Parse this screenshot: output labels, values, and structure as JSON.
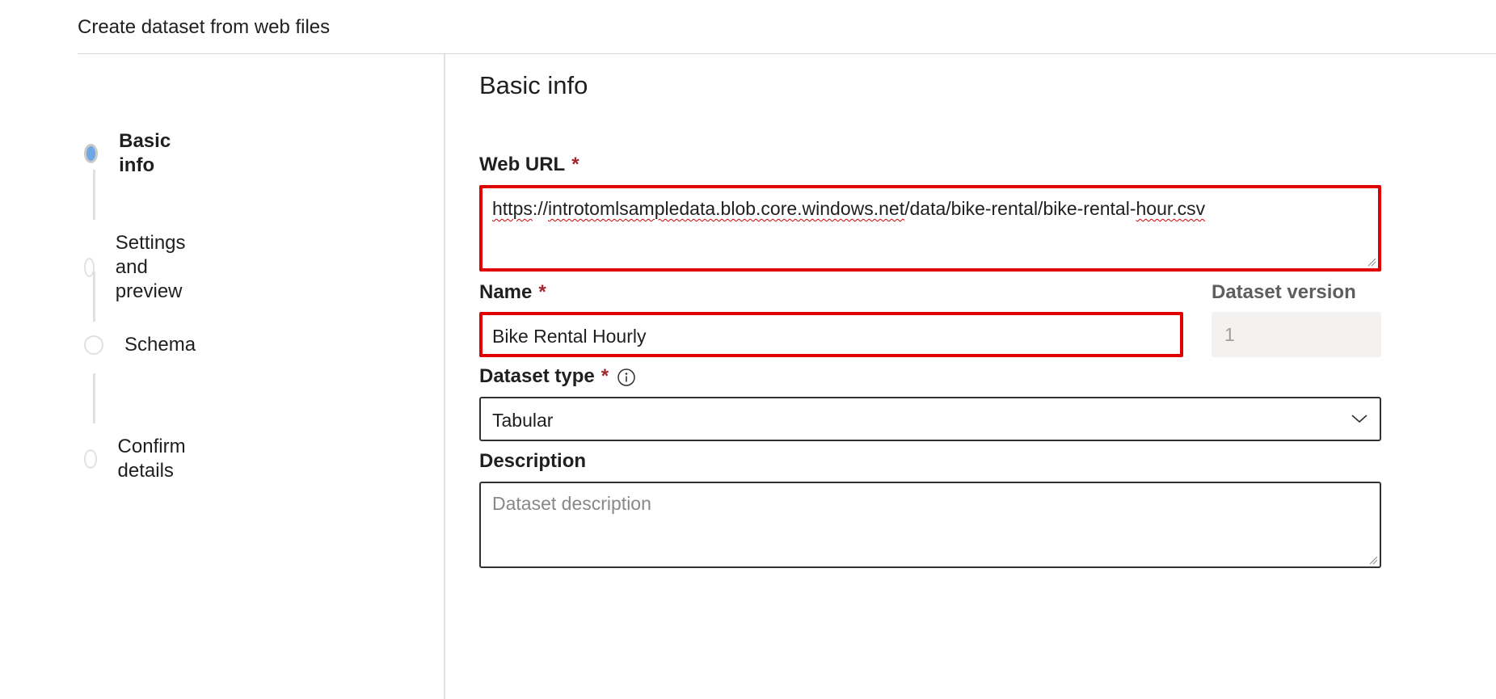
{
  "header": {
    "title": "Create dataset from web files"
  },
  "steps": [
    {
      "label": "Basic info",
      "active": true
    },
    {
      "label": "Settings and preview",
      "active": false
    },
    {
      "label": "Schema",
      "active": false
    },
    {
      "label": "Confirm details",
      "active": false
    }
  ],
  "main": {
    "section_title": "Basic info",
    "web_url": {
      "label": "Web URL",
      "required_mark": "*",
      "value_parts": {
        "p1": "https",
        "p2": "://",
        "p3": "introtomlsampledata.blob.core.windows.net",
        "p4": "/data/bike-rental/bike-rental-",
        "p5": "hour.csv"
      }
    },
    "name": {
      "label": "Name",
      "required_mark": "*",
      "value": "Bike Rental Hourly"
    },
    "dataset_version": {
      "label": "Dataset version",
      "value": "1"
    },
    "dataset_type": {
      "label": "Dataset type",
      "required_mark": "*",
      "value": "Tabular"
    },
    "description": {
      "label": "Description",
      "placeholder": "Dataset description"
    }
  },
  "colors": {
    "highlight_border": "#e00000",
    "active_step": "#6fa6e6",
    "required": "#a4262c"
  },
  "icons": [
    "info-icon",
    "chevron-down-icon",
    "resize-grip-icon"
  ]
}
